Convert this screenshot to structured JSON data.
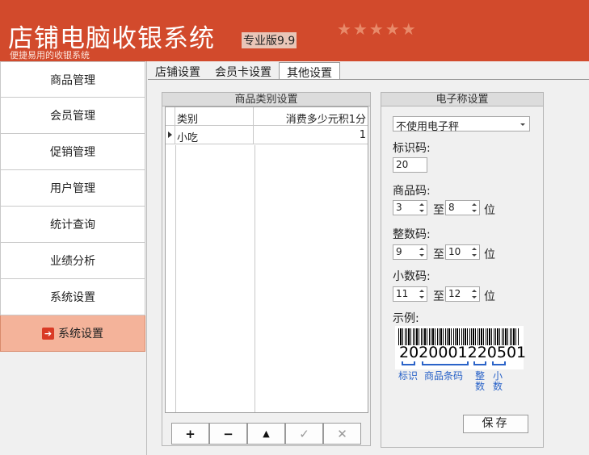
{
  "header": {
    "title": "店铺电脑收银系统",
    "edition": "专业版9.9",
    "tagline": "便捷易用的收银系统",
    "stars": "★★★★★"
  },
  "sidebar": {
    "items": [
      {
        "label": "商品管理"
      },
      {
        "label": "会员管理"
      },
      {
        "label": "促销管理"
      },
      {
        "label": "用户管理"
      },
      {
        "label": "统计查询"
      },
      {
        "label": "业绩分析"
      },
      {
        "label": "系统设置"
      },
      {
        "label": "系统设置",
        "icon": "exit-icon"
      }
    ]
  },
  "tabs": [
    {
      "label": "店铺设置"
    },
    {
      "label": "会员卡设置"
    },
    {
      "label": "其他设置"
    }
  ],
  "category_panel": {
    "title": "商品类别设置",
    "columns": [
      "类别",
      "消费多少元积1分"
    ],
    "rows": [
      {
        "category": "小吃",
        "value": "1"
      }
    ],
    "buttons": [
      "+",
      "−",
      "▲",
      "✓",
      "✕"
    ]
  },
  "scale_panel": {
    "title": "电子称设置",
    "mode_select": "不使用电子秤",
    "id_code_label": "标识码:",
    "id_code_value": "20",
    "product_code_label": "商品码:",
    "product_from": "3",
    "product_to": "8",
    "integer_label": "整数码:",
    "integer_from": "9",
    "integer_to": "10",
    "decimal_label": "小数码:",
    "decimal_from": "11",
    "decimal_to": "12",
    "to_text": "至",
    "unit_text": "位",
    "example_label": "示例:",
    "barcode_number": "2020001220501",
    "legend": {
      "id": "标识",
      "product": "商品条码",
      "integer": "整数",
      "decimal": "小数"
    },
    "save_label": "保存"
  },
  "colors": {
    "header_bg": "#d24a2c",
    "active_item_bg": "#f4b39a",
    "legend_blue": "#2a63c8"
  }
}
